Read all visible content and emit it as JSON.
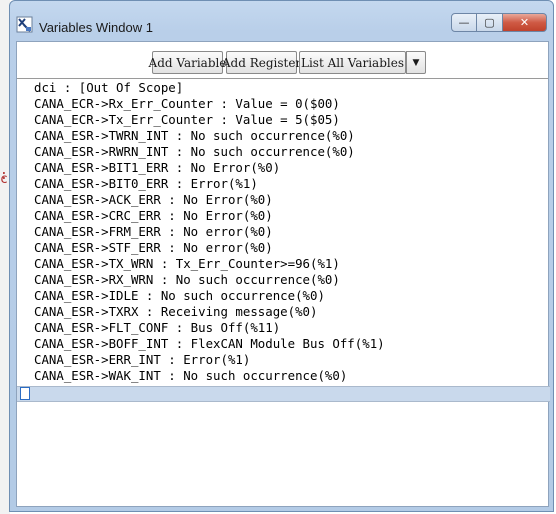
{
  "window": {
    "title": "Variables Window 1",
    "controls": {
      "minimize": "—",
      "maximize": "▢",
      "close": "✕"
    }
  },
  "toolbar": {
    "add_variable_label": "Add Variable",
    "add_register_label": "Add Register",
    "list_all_label": "List All Variables",
    "dropdown_glyph": "▼"
  },
  "variables": [
    "dci : [Out Of Scope]",
    "CANA_ECR->Rx_Err_Counter : Value = 0($00)",
    "CANA_ECR->Tx_Err_Counter : Value = 5($05)",
    "CANA_ESR->TWRN_INT : No such occurrence(%0)",
    "CANA_ESR->RWRN_INT : No such occurrence(%0)",
    "CANA_ESR->BIT1_ERR : No Error(%0)",
    "CANA_ESR->BIT0_ERR : Error(%1)",
    "CANA_ESR->ACK_ERR : No Error(%0)",
    "CANA_ESR->CRC_ERR : No Error(%0)",
    "CANA_ESR->FRM_ERR : No error(%0)",
    "CANA_ESR->STF_ERR : No error(%0)",
    "CANA_ESR->TX_WRN : Tx_Err_Counter>=96(%1)",
    "CANA_ESR->RX_WRN : No such occurrence(%0)",
    "CANA_ESR->IDLE : No such occurrence(%0)",
    "CANA_ESR->TXRX : Receiving message(%0)",
    "CANA_ESR->FLT_CONF : Bus Off(%11)",
    "CANA_ESR->BOFF_INT : FlexCAN Module Bus Off(%1)",
    "CANA_ESR->ERR_INT : Error(%1)",
    "CANA_ESR->WAK_INT : No such occurrence(%0)"
  ],
  "background_glyphs": {
    "a": ":",
    "b": "c)"
  },
  "colors": {
    "selection": "#c9d9ec",
    "titlebar": "#b9cfe9",
    "close_button": "#c0422c"
  }
}
